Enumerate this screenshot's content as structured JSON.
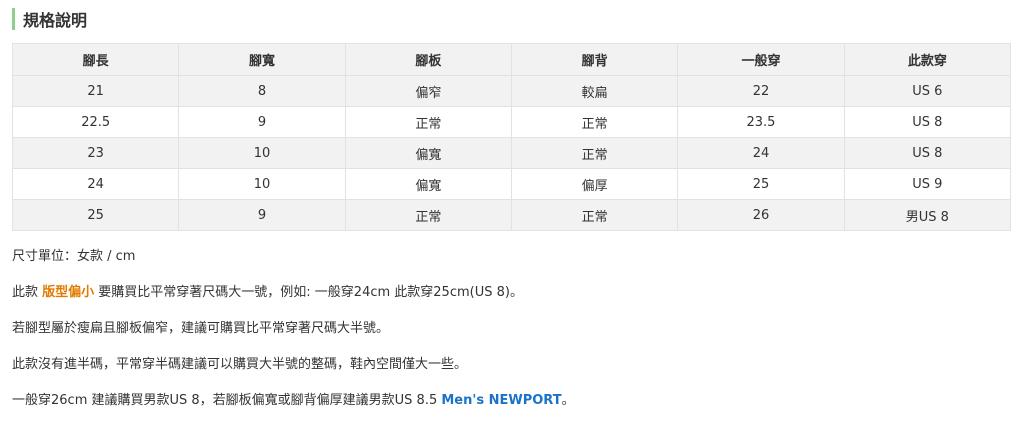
{
  "section": {
    "title": "規格說明"
  },
  "table": {
    "headers": [
      "腳長",
      "腳寬",
      "腳板",
      "腳背",
      "一般穿",
      "此款穿"
    ],
    "rows": [
      [
        "21",
        "8",
        "偏窄",
        "較扁",
        "22",
        "US 6"
      ],
      [
        "22.5",
        "9",
        "正常",
        "正常",
        "23.5",
        "US 8"
      ],
      [
        "23",
        "10",
        "偏寬",
        "正常",
        "24",
        "US 8"
      ],
      [
        "24",
        "10",
        "偏寬",
        "偏厚",
        "25",
        "US 9"
      ],
      [
        "25",
        "9",
        "正常",
        "正常",
        "26",
        "男US 8"
      ]
    ]
  },
  "notes": {
    "unit": "尺寸單位：女款 / cm",
    "line2_prefix": "此款 ",
    "line2_highlight": "版型偏小",
    "line2_suffix": " 要購買比平常穿著尺碼大一號，例如: 一般穿24cm 此款穿25cm(US 8)。",
    "line3": "若腳型屬於瘦扁且腳板偏窄，建議可購買比平常穿著尺碼大半號。",
    "line4": "此款沒有進半碼，平常穿半碼建議可以購買大半號的整碼，鞋內空間僅大一些。",
    "line5_prefix": "一般穿26cm 建議購買男款US 8，若腳板偏寬或腳背偏厚建議男款US 8.5 ",
    "line5_link": "Men's NEWPORT",
    "line5_suffix": "。"
  },
  "colors": {
    "accent_bar": "#8fce8a",
    "highlight": "#e07b00",
    "link": "#1a73c9",
    "stripe": "#f2f2f2"
  }
}
